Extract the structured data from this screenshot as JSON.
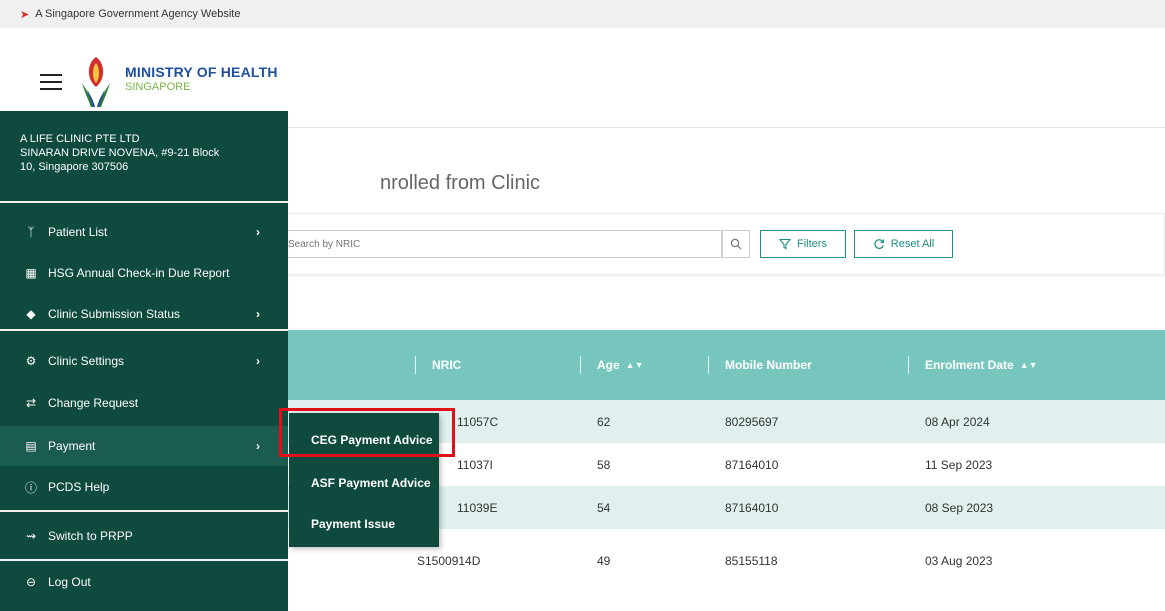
{
  "gov_banner": {
    "text": "A Singapore Government Agency Website"
  },
  "header": {
    "org_line1": "MINISTRY OF HEALTH",
    "org_line2": "SINGAPORE"
  },
  "sidebar": {
    "clinic_name": "A LIFE CLINIC PTE LTD",
    "clinic_address_line1": "SINARAN DRIVE NOVENA, #9-21 Block",
    "clinic_address_line2": "10, Singapore 307506",
    "items": [
      {
        "label": "Patient List",
        "icon": "person-icon"
      },
      {
        "label": "HSG Annual Check-in Due Report",
        "icon": "report-icon"
      },
      {
        "label": "Clinic Submission Status",
        "icon": "diamond-icon"
      },
      {
        "label": "Clinic Settings",
        "icon": "gear-icon"
      },
      {
        "label": "Change Request",
        "icon": "swap-icon"
      },
      {
        "label": "Payment",
        "icon": "card-icon"
      },
      {
        "label": "PCDS Help",
        "icon": "help-icon"
      },
      {
        "label": "Switch to PRPP",
        "icon": "switch-icon"
      },
      {
        "label": "Log Out",
        "icon": "logout-icon"
      }
    ]
  },
  "payment_submenu": [
    "CEG Payment Advice",
    "ASF Payment Advice",
    "Payment Issue"
  ],
  "main": {
    "title_partial": "nrolled from Clinic",
    "search_placeholder": "Search by NRIC",
    "filters_label": "Filters",
    "reset_label": "Reset All"
  },
  "table": {
    "columns": [
      "NRIC",
      "Age",
      "Mobile Number",
      "Enrolment Date"
    ],
    "rows": [
      {
        "nric": "11057C",
        "age": "62",
        "mobile": "80295697",
        "date": "08 Apr 2024"
      },
      {
        "nric": "11037I",
        "age": "58",
        "mobile": "87164010",
        "date": "11 Sep 2023"
      },
      {
        "nric": "11039E",
        "age": "54",
        "mobile": "87164010",
        "date": "08 Sep 2023"
      },
      {
        "nric": "S1500914D",
        "age": "49",
        "mobile": "85155118",
        "date": "03 Aug 2023"
      }
    ]
  },
  "colors": {
    "sidebar_bg": "#0e4a3e",
    "table_header": "#77c6bd",
    "accent": "#1e8f84",
    "highlight": "#e0101a"
  }
}
